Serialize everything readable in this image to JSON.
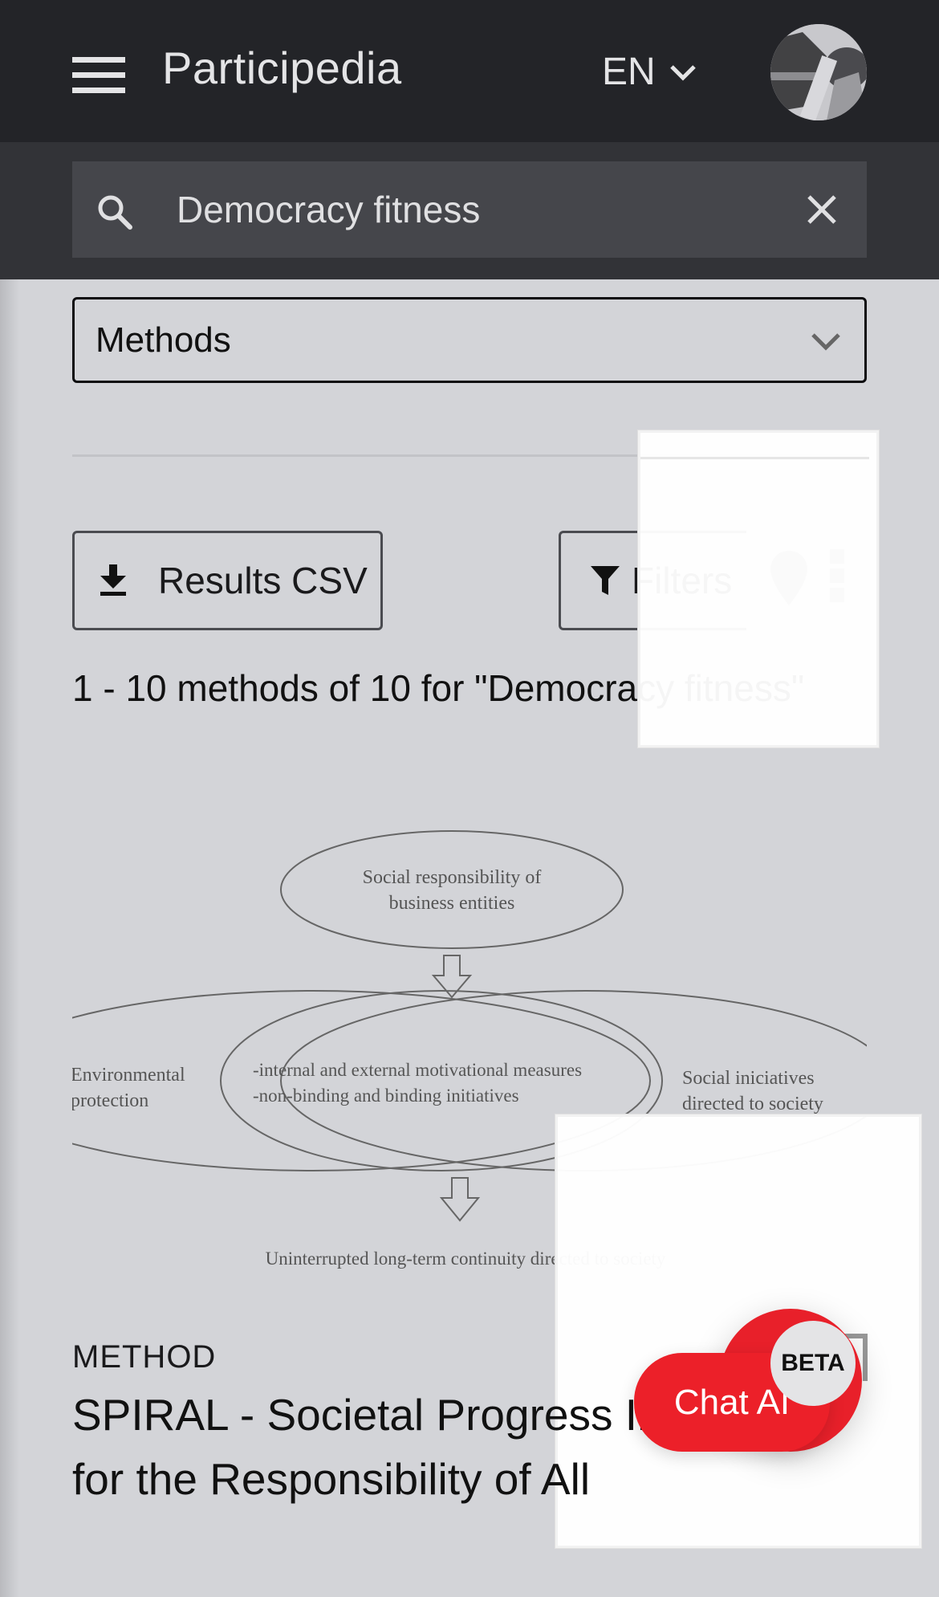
{
  "header": {
    "brand": "Participedia",
    "language": "EN",
    "icons": {
      "menu": "hamburger-menu-icon",
      "lang_chevron": "chevron-down-icon",
      "avatar": "user-avatar"
    }
  },
  "search": {
    "value": "Democracy fitness",
    "icons": {
      "search": "search-icon",
      "clear": "close-icon"
    }
  },
  "content_type_select": {
    "selected": "Methods"
  },
  "toolbar": {
    "csv_label": "Results CSV",
    "filters_label": "Filters",
    "icons": {
      "csv": "download-icon",
      "filters": "filter-icon",
      "map": "map-pin-icon",
      "more": "more-vertical-icon"
    }
  },
  "results": {
    "summary": "1 - 10 methods of 10 for \"Democracy fitness\""
  },
  "diagram": {
    "top": [
      "Social responsibility of",
      "business entities"
    ],
    "left": [
      "Environmental",
      "protection"
    ],
    "center": [
      "-internal and external motivational measures",
      "-non-binding and binding initiatives"
    ],
    "right": [
      "Social iniciatives",
      "directed to society"
    ],
    "bottom": "Uninterrupted long-term continuity directed to society"
  },
  "method_card": {
    "type_label": "METHOD",
    "title": "SPIRAL - Societal Progress Indicators for the Responsibility of All",
    "icons": {
      "bookmark": "bookmark-icon"
    }
  },
  "chat": {
    "label": "Chat AI",
    "badge": "BETA",
    "color": "#ec2029"
  },
  "colors": {
    "topbar": "#232428",
    "searchband": "#323337",
    "page_bg": "#d3d4d8",
    "accent_red": "#ec2029"
  }
}
